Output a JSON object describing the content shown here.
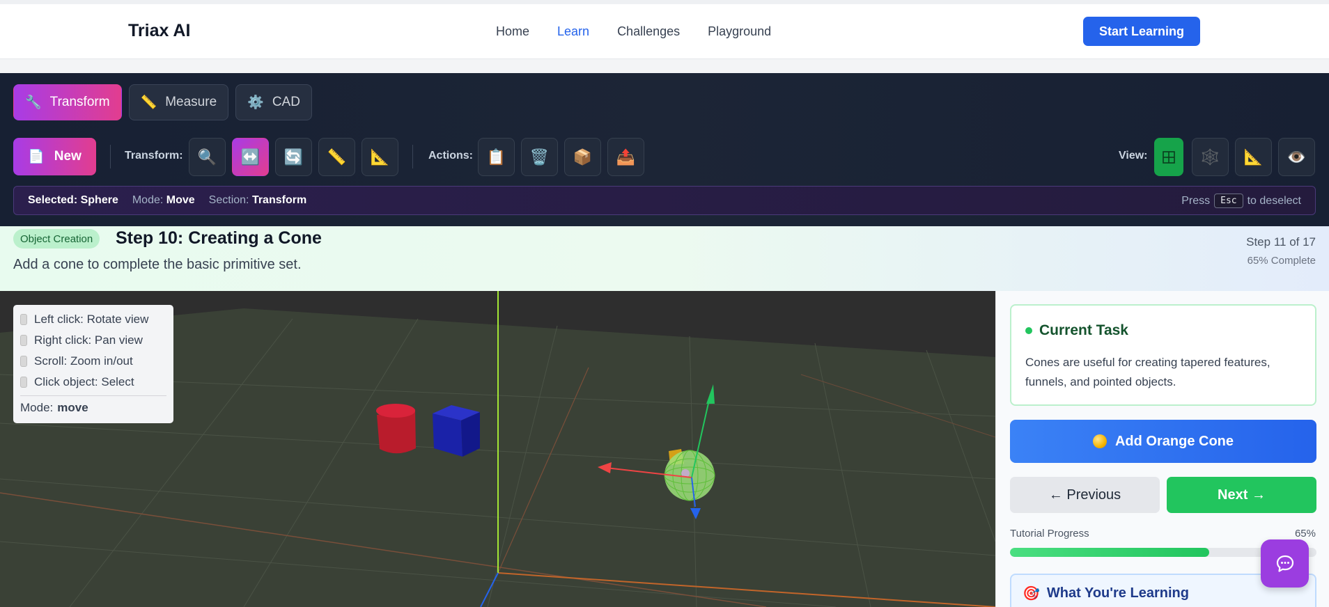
{
  "header": {
    "brand": "Triax AI",
    "nav": [
      "Home",
      "Learn",
      "Challenges",
      "Playground"
    ],
    "active_nav": "Learn",
    "cta": "Start Learning"
  },
  "toolbar": {
    "sections": [
      {
        "label": "Transform",
        "icon": "wrench-icon",
        "active": true
      },
      {
        "label": "Measure",
        "icon": "ruler-icon",
        "active": false
      },
      {
        "label": "CAD",
        "icon": "gear-icon",
        "active": false
      }
    ],
    "new_label": "New",
    "transform_label": "Transform:",
    "actions_label": "Actions:",
    "view_label": "View:",
    "transform_tools": [
      "select-icon",
      "move-icon",
      "rotate-icon",
      "ruler-icon",
      "angle-icon"
    ],
    "action_tools": [
      "clipboard-icon",
      "trash-icon",
      "package-icon",
      "export-icon"
    ],
    "view_tools": [
      "grid-icon",
      "wireframe-icon",
      "angle-icon",
      "eye-icon"
    ],
    "active_transform_tool": "move-icon",
    "active_view_tool": "grid-icon"
  },
  "status": {
    "selected_label": "Selected:",
    "selected_value": "Sphere",
    "mode_label": "Mode:",
    "mode_value": "Move",
    "section_label": "Section:",
    "section_value": "Transform",
    "press_text": "Press",
    "key": "Esc",
    "deselect_text": "to deselect"
  },
  "step": {
    "badge": "Object Creation",
    "title": "Step 10: Creating a Cone",
    "description": "Add a cone to complete the basic primitive set.",
    "counter": "Step 11 of 17",
    "complete": "65% Complete"
  },
  "viewport_help": {
    "items": [
      "Left click: Rotate view",
      "Right click: Pan view",
      "Scroll: Zoom in/out",
      "Click object: Select"
    ],
    "mode_label": "Mode:",
    "mode_value": "move"
  },
  "panel": {
    "task_title": "Current Task",
    "task_text": "Cones are useful for creating tapered features, funnels, and pointed objects.",
    "add_button": "Add Orange Cone",
    "prev_button": "← Previous",
    "next_button": "Next →",
    "progress_label": "Tutorial Progress",
    "progress_value": "65%",
    "progress_fraction": 0.65,
    "learning_title": "What You're Learning"
  },
  "colors": {
    "accent": "#2563eb",
    "brand_gradient_start": "#a83ce6",
    "brand_gradient_end": "#e23d8f",
    "success": "#22c55e"
  }
}
